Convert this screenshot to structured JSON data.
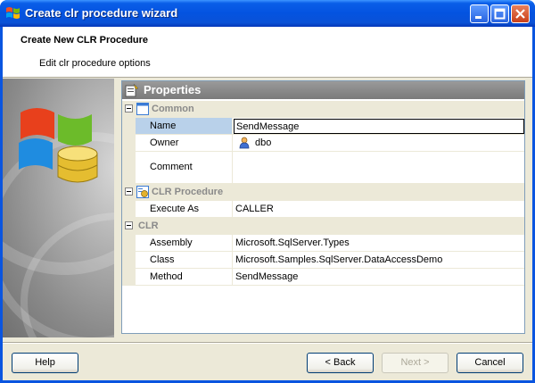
{
  "window": {
    "title": "Create clr procedure wizard"
  },
  "header": {
    "title": "Create New CLR Procedure",
    "subtitle": "Edit clr procedure options"
  },
  "properties": {
    "title": "Properties",
    "categories": [
      {
        "label": "Common",
        "rows": [
          {
            "name": "Name",
            "value": "SendMessage"
          },
          {
            "name": "Owner",
            "value": "dbo"
          },
          {
            "name": "Comment",
            "value": ""
          }
        ]
      },
      {
        "label": "CLR Procedure",
        "rows": [
          {
            "name": "Execute As",
            "value": "CALLER"
          }
        ]
      },
      {
        "label": "CLR",
        "rows": [
          {
            "name": "Assembly",
            "value": "Microsoft.SqlServer.Types"
          },
          {
            "name": "Class",
            "value": "Microsoft.Samples.SqlServer.DataAccessDemo"
          },
          {
            "name": "Method",
            "value": "SendMessage"
          }
        ]
      }
    ]
  },
  "buttons": {
    "help": "Help",
    "back": "< Back",
    "next": "Next >",
    "cancel": "Cancel"
  },
  "colors": {
    "titlebar": "#0453e0",
    "selection": "#b9d1ea",
    "category_bg": "#ece9d8"
  }
}
